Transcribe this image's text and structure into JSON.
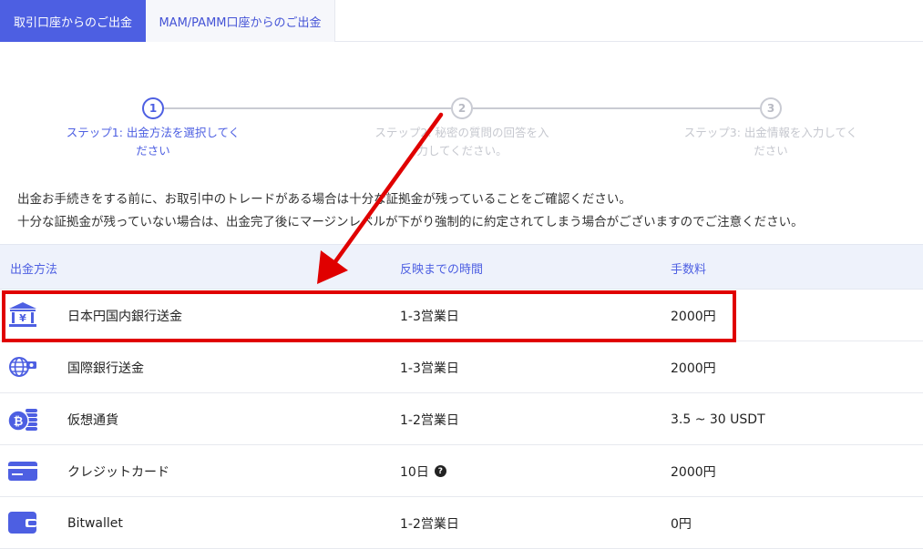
{
  "tabs": {
    "active_label": "取引口座からのご出金",
    "inactive_label": "MAM/PAMM口座からのご出金"
  },
  "stepper": {
    "steps": [
      {
        "number": "1",
        "label": "ステップ1: 出金方法を選択してください"
      },
      {
        "number": "2",
        "label": "ステップ2: 秘密の質問の回答を入力してください。"
      },
      {
        "number": "3",
        "label": "ステップ3: 出金情報を入力してください"
      }
    ],
    "active_step": 1
  },
  "notice": {
    "line1": "出金お手続きをする前に、お取引中のトレードがある場合は十分な証拠金が残っていることをご確認ください。",
    "line2": "十分な証拠金が残っていない場合は、出金完了後にマージンレベルが下がり強制的に約定されてしまう場合がございますのでご注意ください。"
  },
  "table": {
    "headers": {
      "method": "出金方法",
      "time": "反映までの時間",
      "fee": "手数料"
    },
    "rows": [
      {
        "icon": "bank-icon",
        "method": "日本円国内銀行送金",
        "time": "1-3営業日",
        "fee": "2000円"
      },
      {
        "icon": "globe-transfer-icon",
        "method": "国際銀行送金",
        "time": "1-3営業日",
        "fee": "2000円"
      },
      {
        "icon": "bitcoin-icon",
        "method": "仮想通貨",
        "time": "1-2営業日",
        "fee": "3.5 ~ 30 USDT"
      },
      {
        "icon": "credit-card-icon",
        "method": "クレジットカード",
        "time": "10日",
        "fee": "2000円",
        "help_icon": "?"
      },
      {
        "icon": "wallet-icon",
        "method": "Bitwallet",
        "time": "1-2営業日",
        "fee": "0円"
      }
    ]
  },
  "colors": {
    "accent": "#4d5fe2",
    "annotation": "#e00000",
    "header_bg": "#eef2fb"
  }
}
